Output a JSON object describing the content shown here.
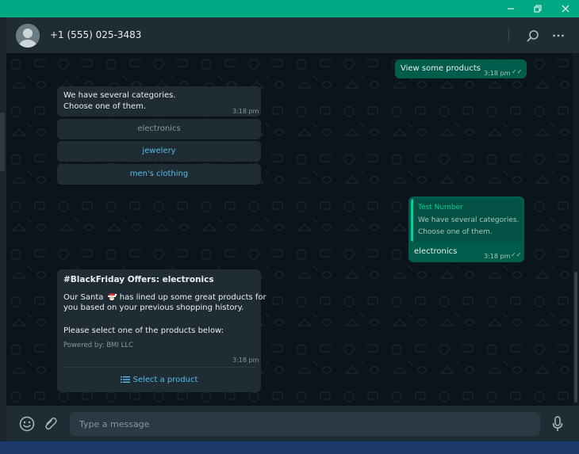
{
  "window": {
    "controls": [
      "minimize",
      "restore",
      "close"
    ]
  },
  "header": {
    "contact_name": "+1 (555) 025-3483"
  },
  "messages": {
    "m1": {
      "text": "View some products",
      "time": "3:18 pm"
    },
    "m2": {
      "line1": "We have several categories.",
      "line2": "Choose one of them.",
      "time": "3:18 pm"
    },
    "list_options": [
      "electronics",
      "jewelery",
      "men's clothing"
    ],
    "m3": {
      "quote_author": "Test Number",
      "quote_line1": "We have several categories.",
      "quote_line2": "Choose one of them.",
      "text": "electronics",
      "time": "3:18 pm"
    },
    "m4": {
      "title": "#BlackFriday Offers: electronics",
      "body1_pre": "Our Santa",
      "body1_post": "has lined up some great products for",
      "body2": "you based on your previous shopping history.",
      "body3": "Please select one of the products below:",
      "footer": "Powered by: BMI LLC",
      "time": "3:18 pm",
      "button": "Select a product"
    }
  },
  "composer": {
    "placeholder": "Type a message"
  },
  "colors": {
    "accent": "#00a884",
    "link": "#53bdeb",
    "incoming": "#202c33",
    "outgoing": "#005c4b",
    "background": "#0b141a"
  }
}
